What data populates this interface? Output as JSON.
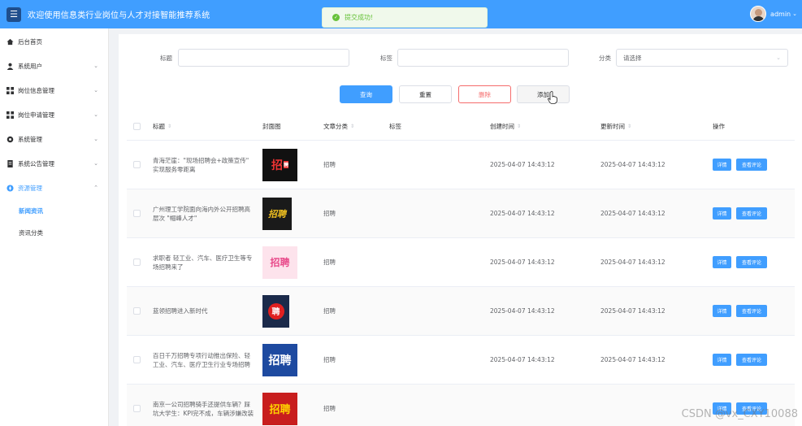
{
  "header": {
    "menu_icon": "hamburger-menu-icon",
    "title": "欢迎使用信息类行业岗位与人才对接智能推荐系统",
    "user_name": "admin",
    "user_caret": "⌄"
  },
  "toast": {
    "icon": "check-circle-icon",
    "message": "提交成功!",
    "color": "#67c23a"
  },
  "sidebar": {
    "items": [
      {
        "label": "后台首页",
        "icon": "home-icon",
        "chevron": ""
      },
      {
        "label": "系统用户",
        "icon": "user-icon",
        "chevron": "⌄"
      },
      {
        "label": "岗位信息管理",
        "icon": "grid-icon",
        "chevron": "⌄"
      },
      {
        "label": "岗位申请管理",
        "icon": "grid-icon",
        "chevron": "⌄"
      },
      {
        "label": "系统管理",
        "icon": "gear-icon",
        "chevron": "⌄"
      },
      {
        "label": "系统公告管理",
        "icon": "document-icon",
        "chevron": "⌄"
      },
      {
        "label": "资源管理",
        "icon": "compass-icon",
        "chevron": "⌃"
      }
    ],
    "subitems": [
      {
        "label": "新闻资讯"
      },
      {
        "label": "资讯分类"
      }
    ]
  },
  "filters": {
    "title_label": "标题",
    "title_value": "",
    "tag_label": "标签",
    "tag_value": "",
    "category_label": "分类",
    "category_placeholder": "请选择"
  },
  "actions": {
    "search": "查询",
    "reset": "重置",
    "delete": "删除",
    "add": "添加"
  },
  "table": {
    "headers": {
      "title": "标题",
      "cover": "封面图",
      "category": "文章分类",
      "tags": "标签",
      "created": "创建时间",
      "updated": "更新时间",
      "ops": "操作"
    },
    "detail_label": "详情",
    "comment_label": "查看评论",
    "rows": [
      {
        "title": "青海茫崖：\"现场招聘会+政策宣传\" 实现服务零距离",
        "category": "招聘",
        "tags": "",
        "created": "2025-04-07 14:43:12",
        "updated": "2025-04-07 14:43:12"
      },
      {
        "title": "广州理工学院面向海内外公开招聘高层次 \"帽峰人才\"",
        "category": "招聘",
        "tags": "",
        "created": "2025-04-07 14:43:12",
        "updated": "2025-04-07 14:43:12"
      },
      {
        "title": "求职者 轻工业、汽车、医疗卫生等专场招聘来了",
        "category": "招聘",
        "tags": "",
        "created": "2025-04-07 14:43:12",
        "updated": "2025-04-07 14:43:12"
      },
      {
        "title": "蓝领招聘进入新时代",
        "category": "招聘",
        "tags": "",
        "created": "2025-04-07 14:43:12",
        "updated": "2025-04-07 14:43:12"
      },
      {
        "title": "百日千万招聘专项行动推出保险、轻工业、汽车、医疗卫生行业专场招聘",
        "category": "招聘",
        "tags": "",
        "created": "2025-04-07 14:43:12",
        "updated": "2025-04-07 14:43:12"
      },
      {
        "title": "南京一公司招聘骑手还提供车辆？踩坑大学生：KPI完不成，车辆涉嫌改装",
        "category": "招聘",
        "tags": "",
        "created": "",
        "updated": ""
      }
    ]
  },
  "watermark": "CSDN @vx_CXY10088"
}
